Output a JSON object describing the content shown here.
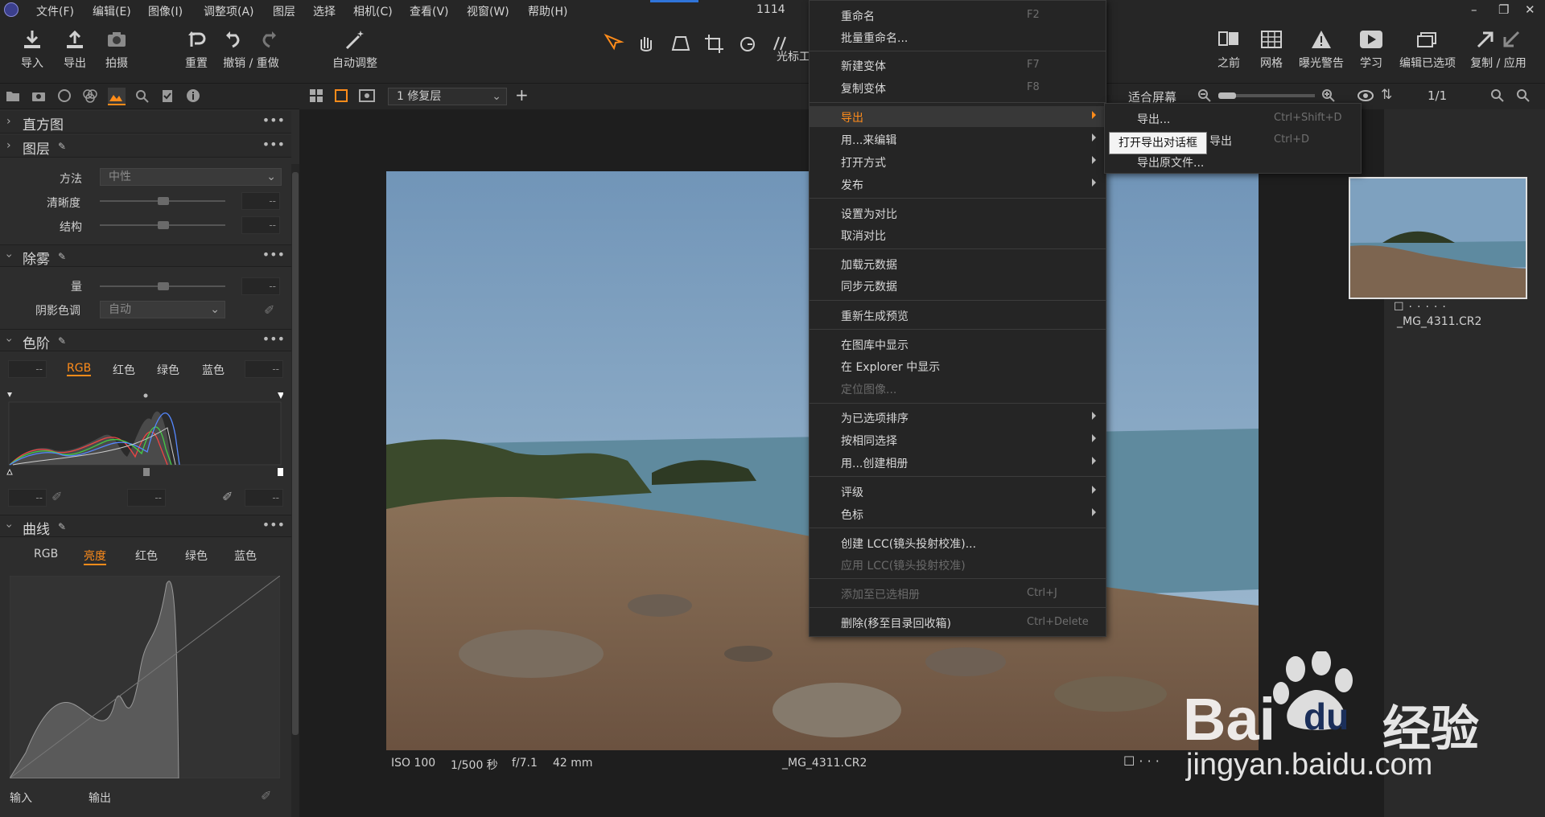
{
  "app": {
    "counter": "1114"
  },
  "menubar": {
    "items": [
      "文件(F)",
      "编辑(E)",
      "图像(I)",
      "调整项(A)",
      "图层",
      "选择",
      "相机(C)",
      "查看(V)",
      "视窗(W)",
      "帮助(H)"
    ]
  },
  "toolbar": {
    "import": "导入",
    "export": "导出",
    "capture": "拍摄",
    "reset": "重置",
    "undo_redo": "撤销 / 重做",
    "auto_adjust": "自动调整",
    "cursor_label": "光标工",
    "before": "之前",
    "grid": "网格",
    "exposure_warn": "曝光警告",
    "learn": "学习",
    "edit_selected": "编辑已选项",
    "copy_apply": "复制 / 应用"
  },
  "viewbar": {
    "variant_select": "1 修复层",
    "fit": "适合屏幕",
    "page": "1/1"
  },
  "left": {
    "histogram": "直方图",
    "layers": "图层",
    "clarity": {
      "method_label": "方法",
      "method_value": "中性",
      "clarity_label": "清晰度",
      "structure_label": "结构",
      "dash": "--"
    },
    "dehaze": {
      "title": "除雾",
      "amount_label": "量",
      "shadow_label": "阴影色调",
      "shadow_value": "自动"
    },
    "levels": {
      "title": "色阶",
      "tabs": [
        "RGB",
        "红色",
        "绿色",
        "蓝色"
      ]
    },
    "curves": {
      "title": "曲线",
      "tabs": [
        "RGB",
        "亮度",
        "红色",
        "绿色",
        "蓝色"
      ],
      "input": "输入",
      "output": "输出"
    }
  },
  "photo_info": {
    "iso": "ISO 100",
    "shutter": "1/500 秒",
    "aperture": "f/7.1",
    "focal": "42 mm",
    "filename": "_MG_4311.CR2"
  },
  "right": {
    "thumb_name": "_MG_4311.CR2"
  },
  "context_menu": {
    "items": [
      {
        "label": "重命名",
        "key": "F2"
      },
      {
        "label": "批量重命名...",
        "key": ""
      },
      {
        "label": "新建变体",
        "key": "F7"
      },
      {
        "label": "复制变体",
        "key": "F8"
      },
      {
        "label": "导出",
        "key": ""
      },
      {
        "label": "用...来编辑",
        "key": ""
      },
      {
        "label": "打开方式",
        "key": ""
      },
      {
        "label": "发布",
        "key": ""
      },
      {
        "label": "设置为对比",
        "key": ""
      },
      {
        "label": "取消对比",
        "key": ""
      },
      {
        "label": "加载元数据",
        "key": ""
      },
      {
        "label": "同步元数据",
        "key": ""
      },
      {
        "label": "重新生成预览",
        "key": ""
      },
      {
        "label": "在图库中显示",
        "key": ""
      },
      {
        "label": "在 Explorer 中显示",
        "key": ""
      },
      {
        "label": "定位图像...",
        "key": ""
      },
      {
        "label": "为已选项排序",
        "key": ""
      },
      {
        "label": "按相同选择",
        "key": ""
      },
      {
        "label": "用...创建相册",
        "key": ""
      },
      {
        "label": "评级",
        "key": ""
      },
      {
        "label": "色标",
        "key": ""
      },
      {
        "label": "创建 LCC(镜头投射校准)...",
        "key": ""
      },
      {
        "label": "应用 LCC(镜头投射校准)",
        "key": ""
      },
      {
        "label": "添加至已选相册",
        "key": "Ctrl+J"
      },
      {
        "label": "删除(移至目录回收箱)",
        "key": "Ctrl+Delete"
      }
    ]
  },
  "submenu": {
    "items": [
      {
        "label": "导出...",
        "key": "Ctrl+Shift+D"
      },
      {
        "label": "导出",
        "key": "Ctrl+D"
      },
      {
        "label": "导出原文件...",
        "key": ""
      }
    ]
  },
  "tooltip": "打开导出对话框",
  "watermark": {
    "brand_a": "Bai",
    "brand_b": "du",
    "brand_c": "经验",
    "url": "jingyan.baidu.com"
  },
  "colors": {
    "accent": "#ff8c1a",
    "bg": "#1f1f1f",
    "panel": "#2d2d2d"
  }
}
